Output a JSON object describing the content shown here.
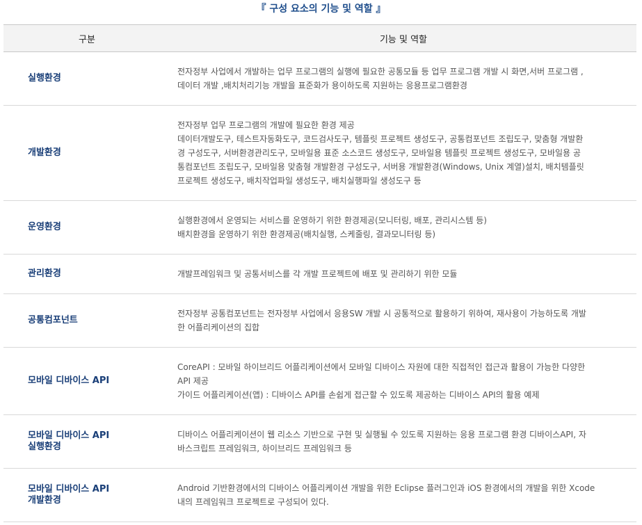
{
  "title": "『 구성 요소의 기능 및 역할 』",
  "headers": {
    "category": "구분",
    "role": "기능 및 역할"
  },
  "rows": [
    {
      "category": "실행환경",
      "lines": [
        "전자정부 사업에서 개발하는 업무 프로그램의 실행에 필요한 공통모듈 등 업무 프로그램 개발 시 화면,서버 프로그램 ,",
        "데이터 개발 ,배치처리기능 개발을 표준화가 용이하도록 지원하는 응용프로그램환경"
      ]
    },
    {
      "category": "개발환경",
      "lines": [
        "전자정부 업무 프로그램의 개발에 필요한 환경 제공",
        "데이터개발도구, 테스트자동화도구, 코드검사도구, 템플릿 프로젝트 생성도구, 공통컴포넌트 조립도구, 맞춤형 개발환",
        "경 구성도구, 서버환경관리도구, 모바일용 표준 소스코드 생성도구, 모바일용 템플릿 프로젝트 생성도구, 모바일용 공",
        "통컴포넌트 조립도구, 모바일용 맞춤형 개발환경 구성도구, 서버용 개발환경(Windows, Unix 계열)설치, 배치템플릿",
        "프로젝트 생성도구, 배치작업파일 생성도구, 배치실행파일 생성도구 등"
      ]
    },
    {
      "category": "운영환경",
      "lines": [
        "실행환경에서 운영되는 서비스를 운영하기 위한 환경제공(모니터링, 배포, 관리시스템 등)",
        "배치환경을 운영하기 위한 환경제공(배치실행, 스케줄링, 결과모니터링 등)"
      ]
    },
    {
      "category": "관리환경",
      "lines": [
        "개발프레임워크 및 공통서비스를 각 개발 프로젝트에 배포 및 관리하기 위한 모듈"
      ]
    },
    {
      "category": "공통컴포넌트",
      "lines": [
        "전자정부 공통컴포넌트는 전자정부 사업에서 응용SW 개발 시 공통적으로 활용하기 위하여, 재사용이 가능하도록 개발",
        "한 어플리케이션의 집합"
      ]
    },
    {
      "category": "모바일 디바이스 API",
      "lines": [
        "CoreAPI : 모바일 하이브리드 어플리케이션에서 모바일 디바이스 자원에 대한 직접적인 접근과 활용이 가능한 다양한",
        "API 제공",
        "가이드 어플리케이션(앱) : 디바이스 API를 손쉽게 접근할 수 있도록 제공하는 디바이스 API의 활용 예제"
      ]
    },
    {
      "category": "모바일 디바이스 API 실행환경",
      "category_lines": [
        "모바일 디바이스 API",
        "실행환경"
      ],
      "lines": [
        "디바이스 어플리케이션이 웹 리소스 기반으로 구현 및 실행될 수 있도록 지원하는 응용 프로그램 환경 디바이스API, 자",
        "바스크립트 프레임워크, 하이브리드 프레임워크 등"
      ]
    },
    {
      "category": "모바일 디바이스 API 개발환경",
      "category_lines": [
        "모바일 디바이스 API",
        "개발환경"
      ],
      "lines": [
        "Android 기반환경에서의 디바이스 어플리케이션 개발을 위한 Eclipse 플러그인과 iOS 환경에서의 개발을 위한 Xcode",
        "내의 프레임워크 프로젝트로 구성되어 있다."
      ]
    }
  ]
}
